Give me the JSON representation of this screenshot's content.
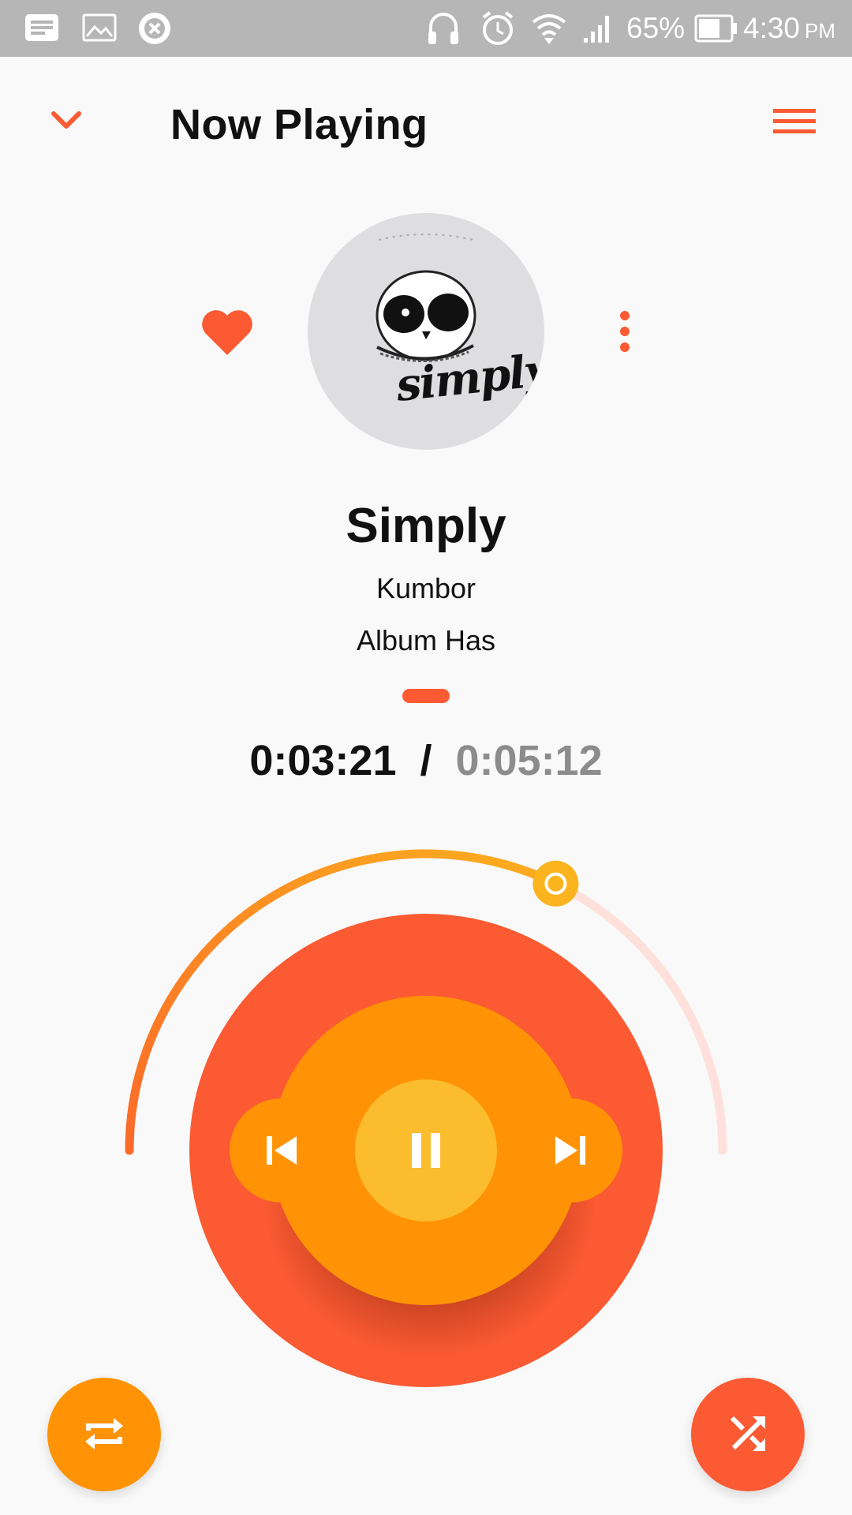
{
  "status_bar": {
    "battery_percent": "65%",
    "time": "4:30",
    "ampm": "PM",
    "icons": [
      "message-icon",
      "image-icon",
      "blocked-icon",
      "headphones-icon",
      "alarm-icon",
      "wifi-icon",
      "signal-icon",
      "battery-icon"
    ]
  },
  "header": {
    "title": "Now Playing",
    "collapse_icon": "chevron-down-icon",
    "menu_icon": "menu-icon"
  },
  "track": {
    "title": "Simply",
    "artist": "Kumbor",
    "album": "Album Has",
    "album_art_text": "simply",
    "favorite_icon": "heart-icon",
    "more_icon": "more-vertical-icon"
  },
  "playback": {
    "elapsed": "0:03:21",
    "separator": "/",
    "total": "0:05:12",
    "progress_fraction": 0.644,
    "state": "playing"
  },
  "controls": {
    "previous_icon": "skip-previous-icon",
    "pause_icon": "pause-icon",
    "next_icon": "skip-next-icon",
    "repeat_icon": "repeat-icon",
    "shuffle_icon": "shuffle-icon"
  },
  "colors": {
    "accent": "#fb5a32",
    "orange": "#ff9305",
    "yellow": "#fbbd2e",
    "track_remaining": "#ffe0db",
    "status_bar": "#b6b6b6"
  }
}
